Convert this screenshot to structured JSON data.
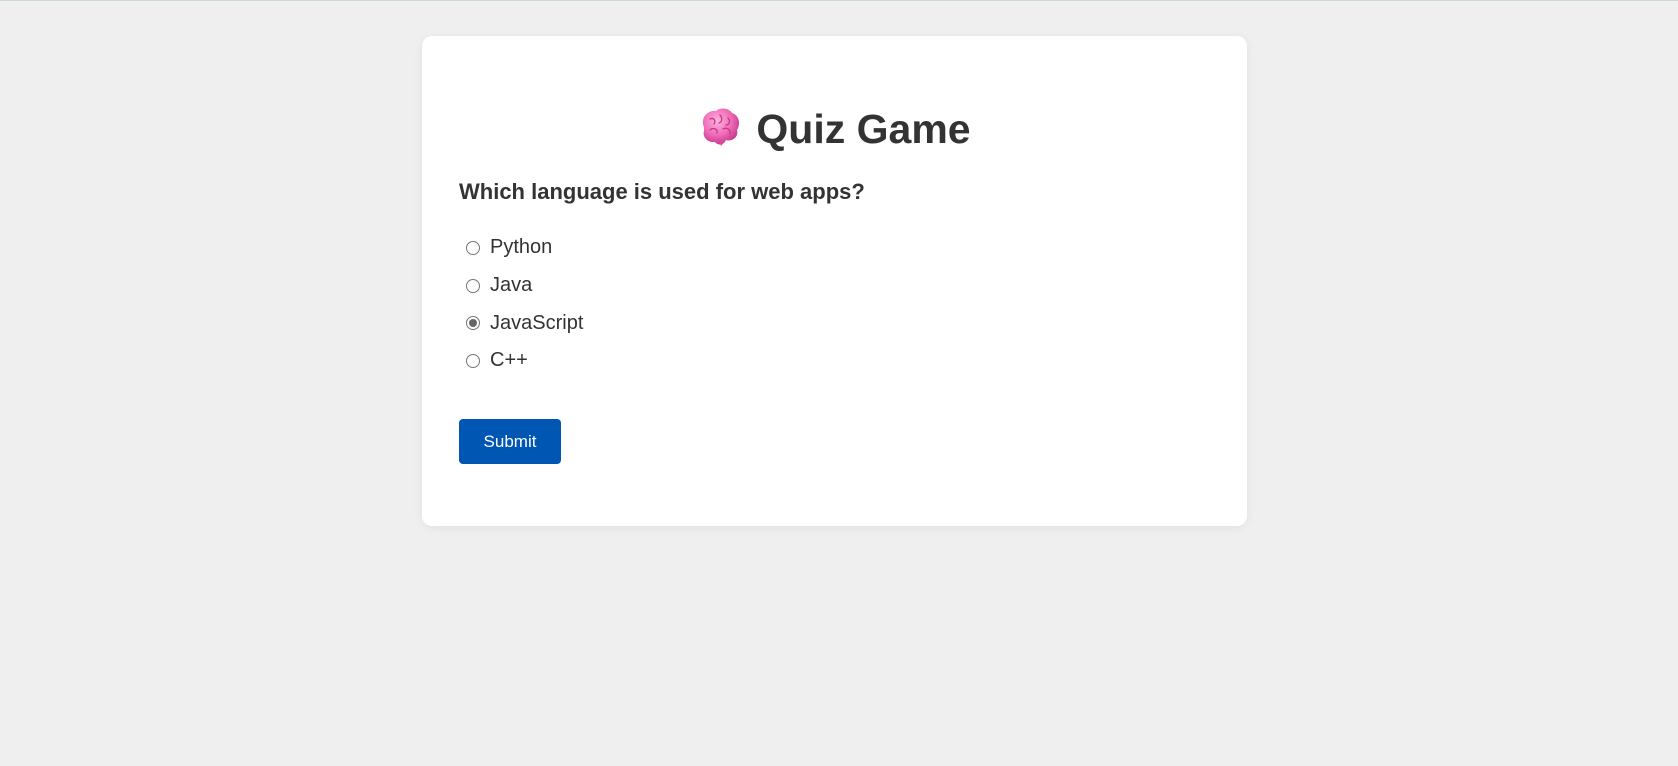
{
  "quiz": {
    "title": "Quiz Game",
    "title_icon": "brain-icon",
    "question": "Which language is used for web apps?",
    "options": [
      {
        "label": "Python",
        "selected": false
      },
      {
        "label": "Java",
        "selected": false
      },
      {
        "label": "JavaScript",
        "selected": true
      },
      {
        "label": "C++",
        "selected": false
      }
    ],
    "submit_label": "Submit"
  },
  "colors": {
    "background": "#efefef",
    "card": "#ffffff",
    "text": "#333333",
    "accent": "#0056b3",
    "brain": "#f06bb8"
  }
}
